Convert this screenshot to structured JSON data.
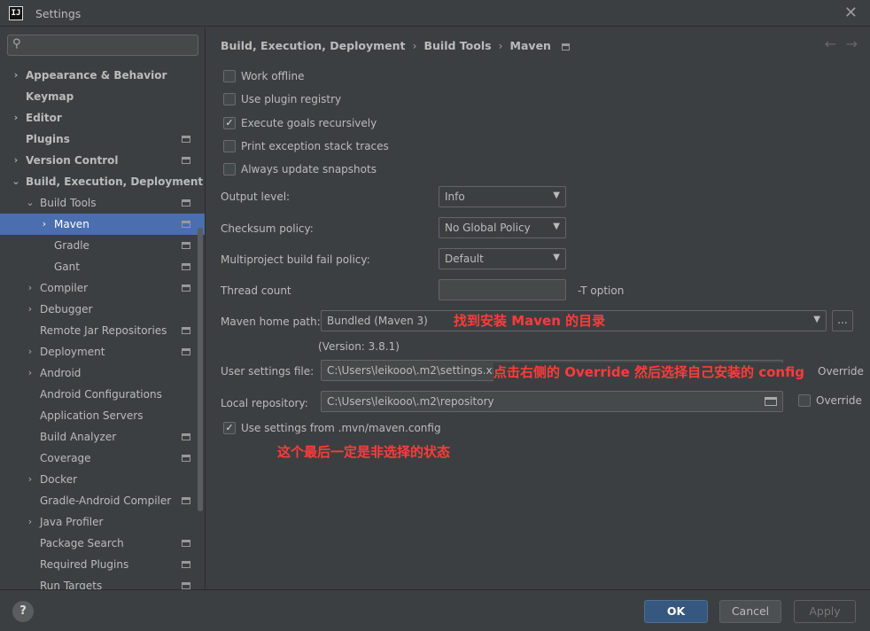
{
  "window": {
    "title": "Settings",
    "logo": "IJ"
  },
  "search": {
    "placeholder": ""
  },
  "sidebar": {
    "items": [
      {
        "label": "Appearance & Behavior",
        "bold": true,
        "chevron": "›",
        "indent": 0,
        "proj": false,
        "selected": false
      },
      {
        "label": "Keymap",
        "bold": true,
        "chevron": "",
        "indent": 0,
        "proj": false,
        "selected": false
      },
      {
        "label": "Editor",
        "bold": true,
        "chevron": "›",
        "indent": 0,
        "proj": false,
        "selected": false
      },
      {
        "label": "Plugins",
        "bold": true,
        "chevron": "",
        "indent": 0,
        "proj": true,
        "selected": false
      },
      {
        "label": "Version Control",
        "bold": true,
        "chevron": "›",
        "indent": 0,
        "proj": true,
        "selected": false
      },
      {
        "label": "Build, Execution, Deployment",
        "bold": true,
        "chevron": "⌄",
        "indent": 0,
        "proj": false,
        "selected": false
      },
      {
        "label": "Build Tools",
        "bold": false,
        "chevron": "⌄",
        "indent": 1,
        "proj": true,
        "selected": false
      },
      {
        "label": "Maven",
        "bold": false,
        "chevron": "›",
        "indent": 2,
        "proj": true,
        "selected": true
      },
      {
        "label": "Gradle",
        "bold": false,
        "chevron": "",
        "indent": 2,
        "proj": true,
        "selected": false
      },
      {
        "label": "Gant",
        "bold": false,
        "chevron": "",
        "indent": 2,
        "proj": true,
        "selected": false
      },
      {
        "label": "Compiler",
        "bold": false,
        "chevron": "›",
        "indent": 1,
        "proj": true,
        "selected": false
      },
      {
        "label": "Debugger",
        "bold": false,
        "chevron": "›",
        "indent": 1,
        "proj": false,
        "selected": false
      },
      {
        "label": "Remote Jar Repositories",
        "bold": false,
        "chevron": "",
        "indent": 1,
        "proj": true,
        "selected": false
      },
      {
        "label": "Deployment",
        "bold": false,
        "chevron": "›",
        "indent": 1,
        "proj": true,
        "selected": false
      },
      {
        "label": "Android",
        "bold": false,
        "chevron": "›",
        "indent": 1,
        "proj": false,
        "selected": false
      },
      {
        "label": "Android Configurations",
        "bold": false,
        "chevron": "",
        "indent": 1,
        "proj": false,
        "selected": false
      },
      {
        "label": "Application Servers",
        "bold": false,
        "chevron": "",
        "indent": 1,
        "proj": false,
        "selected": false
      },
      {
        "label": "Build Analyzer",
        "bold": false,
        "chevron": "",
        "indent": 1,
        "proj": true,
        "selected": false
      },
      {
        "label": "Coverage",
        "bold": false,
        "chevron": "",
        "indent": 1,
        "proj": true,
        "selected": false
      },
      {
        "label": "Docker",
        "bold": false,
        "chevron": "›",
        "indent": 1,
        "proj": false,
        "selected": false
      },
      {
        "label": "Gradle-Android Compiler",
        "bold": false,
        "chevron": "",
        "indent": 1,
        "proj": true,
        "selected": false
      },
      {
        "label": "Java Profiler",
        "bold": false,
        "chevron": "›",
        "indent": 1,
        "proj": false,
        "selected": false
      },
      {
        "label": "Package Search",
        "bold": false,
        "chevron": "",
        "indent": 1,
        "proj": true,
        "selected": false
      },
      {
        "label": "Required Plugins",
        "bold": false,
        "chevron": "",
        "indent": 1,
        "proj": true,
        "selected": false
      },
      {
        "label": "Run Targets",
        "bold": false,
        "chevron": "",
        "indent": 1,
        "proj": true,
        "selected": false
      }
    ]
  },
  "breadcrumb": {
    "part1": "Build, Execution, Deployment",
    "part2": "Build Tools",
    "part3": "Maven",
    "sep": "›"
  },
  "nav": {
    "back": "←",
    "forward": "→"
  },
  "checkboxes": {
    "work_offline": {
      "label": "Work offline",
      "checked": false
    },
    "plugin_registry": {
      "label": "Use plugin registry",
      "checked": false
    },
    "execute_recursively": {
      "label": "Execute goals recursively",
      "checked": true
    },
    "print_stack": {
      "label": "Print exception stack traces",
      "checked": false
    },
    "update_snapshots": {
      "label": "Always update snapshots",
      "checked": false
    },
    "use_mvn_config": {
      "label": "Use settings from .mvn/maven.config",
      "checked": true
    }
  },
  "form": {
    "output_level_label": "Output level:",
    "output_level_value": "Info",
    "checksum_label": "Checksum policy:",
    "checksum_value": "No Global Policy",
    "fail_policy_label": "Multiproject build fail policy:",
    "fail_policy_value": "Default",
    "thread_label": "Thread count",
    "thread_value": "",
    "thread_suffix": "-T option",
    "maven_home_label": "Maven home path:",
    "maven_home_value": "Bundled (Maven 3)",
    "browse": "...",
    "version_text": "(Version: 3.8.1)",
    "user_settings_label": "User settings file:",
    "user_settings_value": "C:\\Users\\leikooo\\.m2\\settings.xml",
    "user_override": "Override",
    "local_repo_label": "Local repository:",
    "local_repo_value": "C:\\Users\\leikooo\\.m2\\repository",
    "local_override": "Override"
  },
  "annotations": {
    "maven_home_note": "找到安装 Maven 的目录",
    "user_settings_note": "点击右侧的 Override 然后选择自己安装的 config",
    "mvn_config_note": "这个最后一定是非选择的状态"
  },
  "buttons": {
    "help": "?",
    "ok": "OK",
    "cancel": "Cancel",
    "apply": "Apply"
  },
  "colors": {
    "background": "#3c3f41",
    "selection": "#4b6eaf",
    "annotation": "#ff3b3b",
    "ok": "#365880"
  }
}
